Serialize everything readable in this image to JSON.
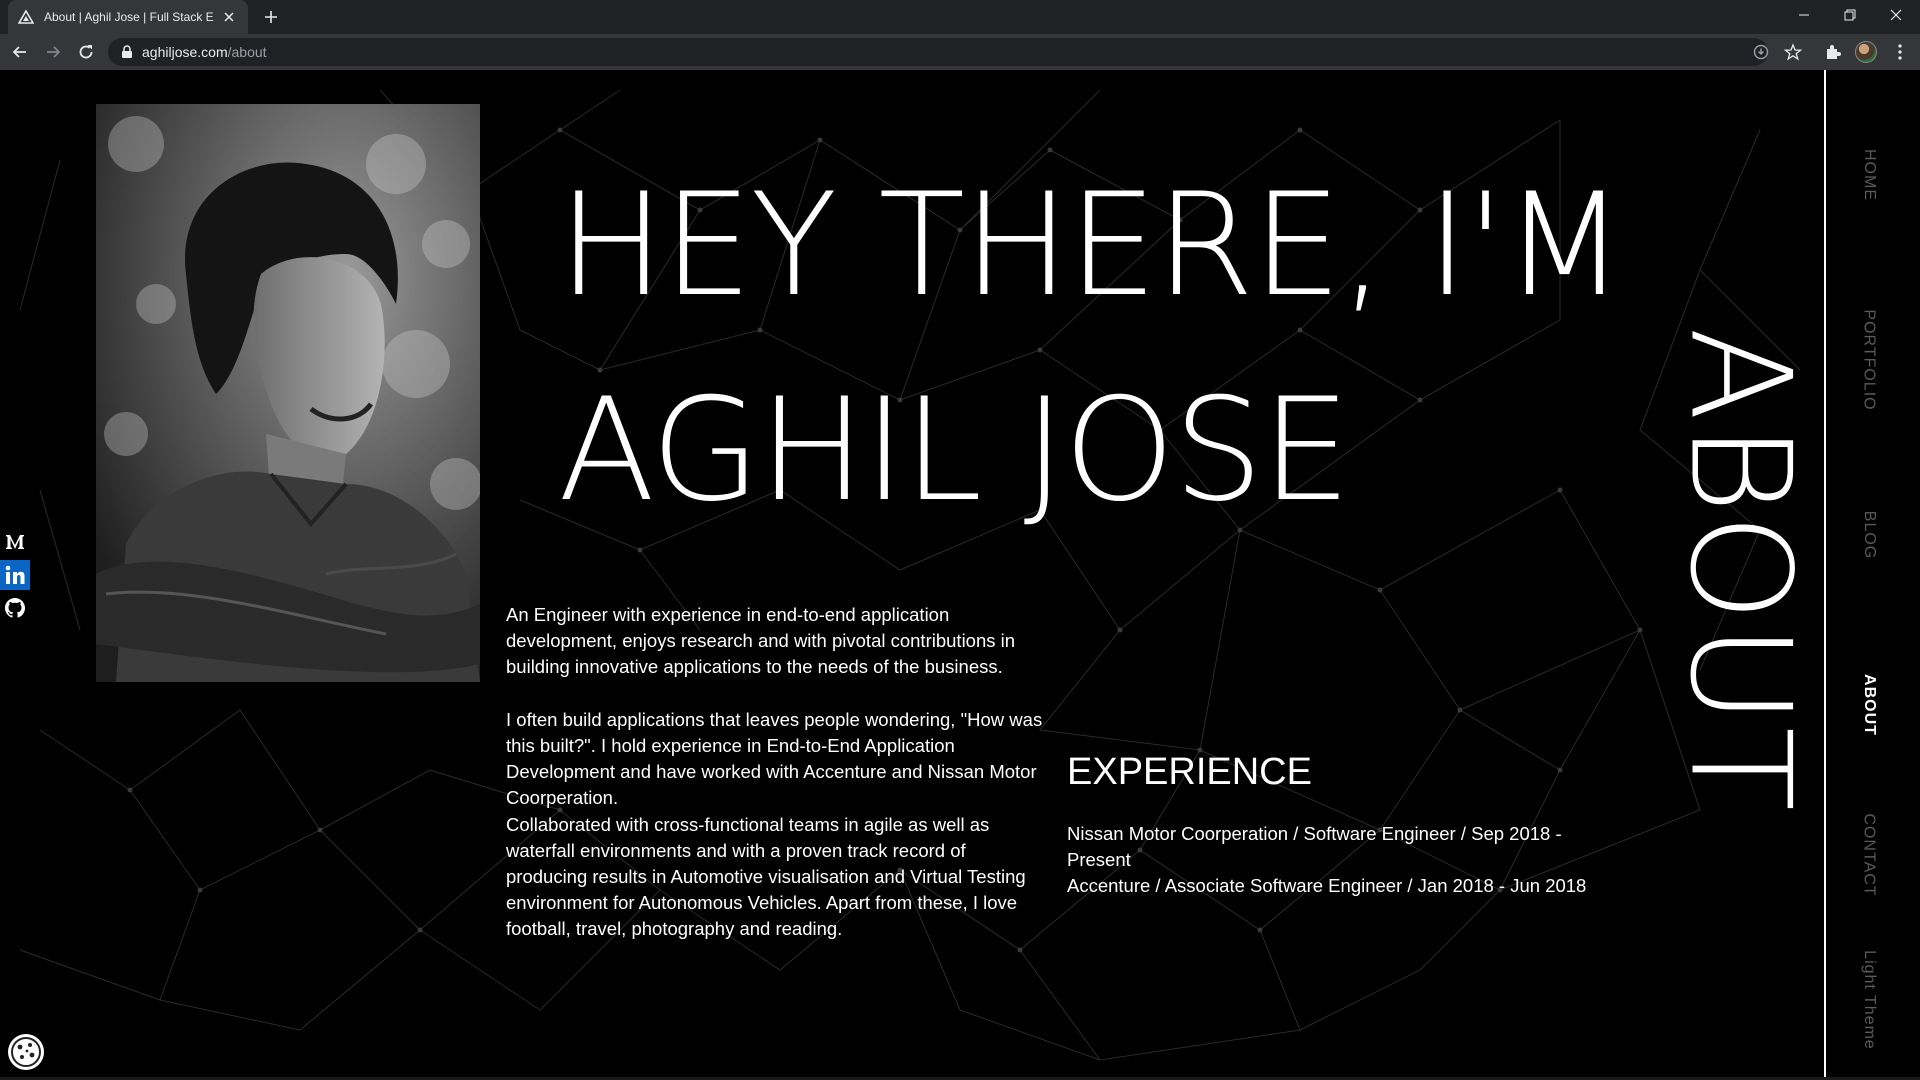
{
  "browser": {
    "tab_title": "About | Aghil Jose | Full Stack Engineer",
    "url_domain": "aghiljose.com",
    "url_path": "/about"
  },
  "hero": {
    "line1": "HEY THERE, I'M",
    "line2": "AGHIL JOSE"
  },
  "bio": {
    "paragraphs": [
      "An Engineer with experience in end-to-end application development, enjoys research and with pivotal contributions in building innovative applications to the needs of the business.",
      "I often build applications that leaves people wondering, \"How was this built?\". I hold experience in End-to-End Application Development and have worked with Accenture and Nissan Motor Coorperation.",
      "Collaborated with cross-functional teams in agile as well as waterfall environments and with a proven track record of producing results in Automotive visualisation and Virtual Testing environment for Autonomous Vehicles. Apart from these, I love football, travel, photography and reading."
    ]
  },
  "experience": {
    "title": "EXPERIENCE",
    "entries": [
      "Nissan Motor Coorperation / Software Engineer / Sep 2018 - Present",
      "Accenture / Associate Software Engineer / Jan 2018 - Jun 2018"
    ]
  },
  "section_label": "ABOUT",
  "nav": {
    "items": [
      {
        "label": "HOME"
      },
      {
        "label": "PORTFOLIO"
      },
      {
        "label": "BLOG"
      },
      {
        "label": "ABOUT"
      },
      {
        "label": "CONTACT"
      },
      {
        "label": "Light Theme"
      }
    ],
    "active": "ABOUT"
  },
  "social": [
    {
      "icon": "medium-icon"
    },
    {
      "icon": "linkedin-icon"
    },
    {
      "icon": "github-icon"
    }
  ],
  "colors": {
    "background": "#000000",
    "text": "#ffffff",
    "nav_inactive": "#5b5b5b",
    "linkedin": "#0a66c2"
  }
}
